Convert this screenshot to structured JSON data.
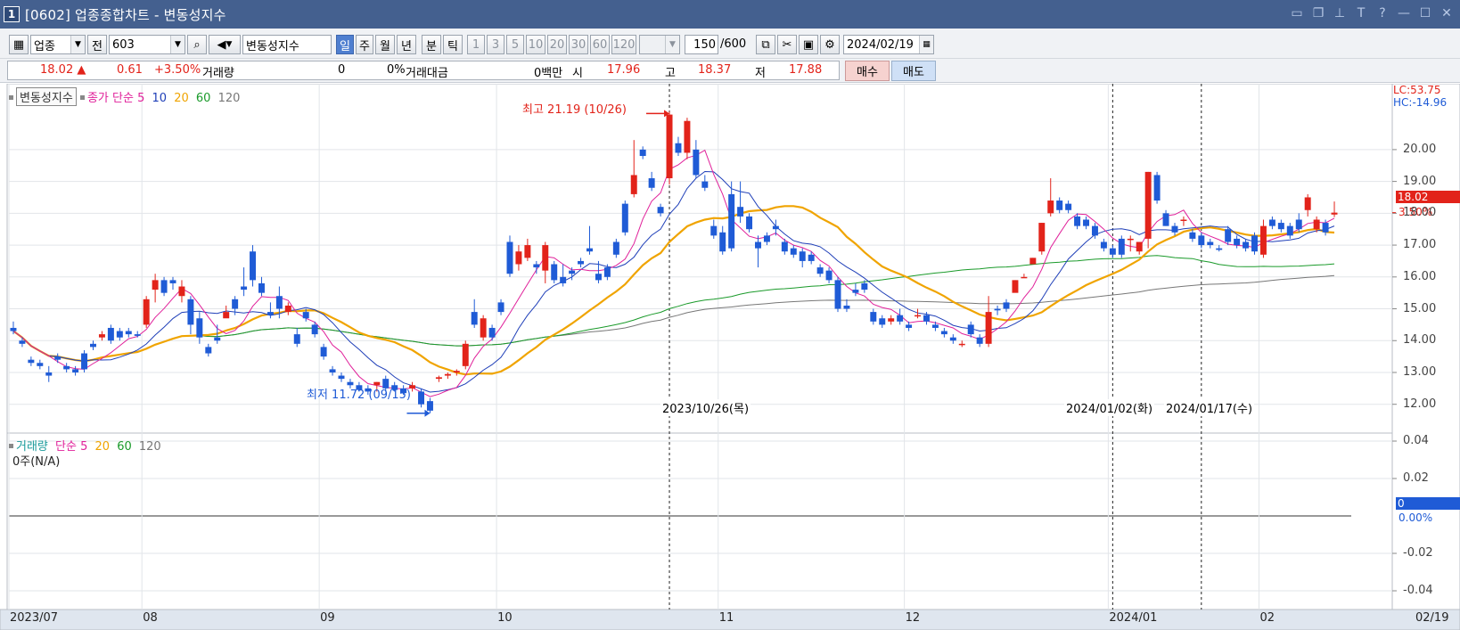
{
  "window": {
    "app_icon_text": "1",
    "title": "[0602] 업종종합차트 - 변동성지수",
    "buttons": [
      "▢",
      "❐",
      "📌",
      "T",
      "?",
      "—",
      "☐",
      "✕"
    ]
  },
  "toolbar": {
    "category_value": "업종",
    "jeon_label": "전",
    "code_value": "603",
    "search_icon": "search-icon",
    "index_name": "변동성지수",
    "period_buttons": [
      "일",
      "주",
      "월",
      "년",
      "분",
      "틱"
    ],
    "selected_period": "일",
    "interval_buttons": [
      "1",
      "3",
      "5",
      "10",
      "20",
      "30",
      "60",
      "120"
    ],
    "count_value": "150",
    "count_max": "/600",
    "date_value": "2024/02/19"
  },
  "price_info": {
    "current": "18.02 ▲",
    "change": "0.61",
    "change_pct": "+3.50%",
    "volume_label": "거래량",
    "volume_value": "0",
    "volume_pct": "0%",
    "amount_label": "거래대금",
    "amount_value": "0백만",
    "open_label": "시",
    "open_value": "17.96",
    "high_label": "고",
    "high_value": "18.37",
    "low_label": "저",
    "low_value": "17.88",
    "buy_label": "매수",
    "sell_label": "매도"
  },
  "price_legend": {
    "name": "변동성지수",
    "close_label": "종가 단순",
    "ma": [
      "5",
      "10",
      "20",
      "60",
      "120"
    ]
  },
  "volume_legend": {
    "name": "거래량",
    "ma_label": "단순",
    "ma": [
      "5",
      "20",
      "60",
      "120"
    ],
    "value_text": "0주(N/A)"
  },
  "annotations": {
    "high": "최고 21.19 (10/26)",
    "low": "최저 11.72 (09/15)",
    "lc": "LC:53.75",
    "hc": "HC:-14.96",
    "last_price": "18.02",
    "last_pct": "3.50%",
    "vol_last": "0",
    "vol_pct": "0.00%",
    "date_markers": [
      "2023/10/26(목)",
      "2024/01/02(화)",
      "2024/01/17(수)"
    ]
  },
  "colors": {
    "up": "#e2231a",
    "down": "#1f5bd6",
    "ma5": "#e0209a",
    "ma10": "#1f3fb8",
    "ma20": "#f0a400",
    "ma60": "#1a9a2a",
    "ma120": "#777777"
  },
  "x_axis_labels": [
    "2023/07",
    "08",
    "09",
    "10",
    "11",
    "12",
    "2024/01",
    "02",
    "02/19"
  ],
  "chart_data": {
    "type": "candlestick",
    "y_ticks": [
      "20.00",
      "19.00",
      "18.00",
      "17.00",
      "16.00",
      "15.00",
      "14.00",
      "13.00",
      "12.00"
    ],
    "ylim": [
      11.6,
      21.9
    ],
    "vol_ticks": [
      "0.04",
      "0.02",
      "-0.02",
      "-0.04"
    ],
    "vol_ylim": [
      -0.05,
      0.05
    ],
    "candles": [
      [
        14.4,
        14.6,
        14.2,
        14.3
      ],
      [
        14.0,
        14.1,
        13.8,
        13.9
      ],
      [
        13.4,
        13.5,
        13.2,
        13.3
      ],
      [
        13.3,
        13.4,
        13.1,
        13.2
      ],
      [
        13.0,
        13.2,
        12.7,
        12.9
      ],
      [
        13.5,
        13.6,
        13.3,
        13.4
      ],
      [
        13.2,
        13.3,
        13.0,
        13.1
      ],
      [
        13.1,
        13.2,
        12.9,
        13.0
      ],
      [
        13.6,
        13.7,
        13.0,
        13.1
      ],
      [
        13.9,
        14.0,
        13.7,
        13.8
      ],
      [
        14.1,
        14.3,
        14.0,
        14.2
      ],
      [
        14.4,
        14.5,
        13.9,
        14.0
      ],
      [
        14.3,
        14.4,
        14.0,
        14.1
      ],
      [
        14.3,
        14.4,
        14.1,
        14.2
      ],
      [
        14.2,
        14.3,
        14.1,
        14.15
      ],
      [
        14.5,
        15.4,
        14.4,
        15.3
      ],
      [
        15.6,
        16.1,
        15.2,
        15.9
      ],
      [
        15.9,
        16.0,
        15.4,
        15.5
      ],
      [
        15.9,
        16.0,
        15.6,
        15.8
      ],
      [
        15.4,
        15.9,
        15.2,
        15.7
      ],
      [
        15.3,
        15.4,
        14.2,
        14.5
      ],
      [
        14.7,
        14.9,
        13.9,
        14.1
      ],
      [
        13.8,
        13.9,
        13.5,
        13.6
      ],
      [
        14.1,
        14.5,
        13.9,
        14.0
      ],
      [
        14.7,
        15.1,
        14.8,
        14.9
      ],
      [
        15.3,
        15.4,
        14.8,
        15.0
      ],
      [
        15.7,
        16.3,
        15.4,
        15.6
      ],
      [
        16.8,
        17.0,
        15.7,
        15.9
      ],
      [
        15.8,
        16.0,
        15.4,
        15.5
      ],
      [
        14.9,
        15.2,
        14.7,
        14.8
      ],
      [
        15.4,
        15.7,
        14.7,
        15.0
      ],
      [
        14.9,
        15.2,
        14.8,
        15.1
      ],
      [
        14.2,
        14.4,
        13.8,
        13.9
      ],
      [
        14.9,
        15.0,
        14.6,
        14.7
      ],
      [
        14.5,
        14.6,
        14.1,
        14.2
      ],
      [
        13.8,
        13.9,
        13.4,
        13.5
      ],
      [
        13.1,
        13.2,
        12.9,
        13.0
      ],
      [
        12.9,
        13.0,
        12.7,
        12.8
      ],
      [
        12.7,
        12.8,
        12.5,
        12.6
      ],
      [
        12.6,
        12.7,
        12.4,
        12.45
      ],
      [
        12.5,
        12.6,
        12.3,
        12.4
      ],
      [
        12.6,
        12.7,
        12.4,
        12.7
      ],
      [
        12.8,
        12.9,
        12.4,
        12.5
      ],
      [
        12.6,
        12.7,
        12.4,
        12.45
      ],
      [
        12.5,
        12.6,
        12.3,
        12.35
      ],
      [
        12.5,
        12.7,
        12.4,
        12.6
      ],
      [
        12.4,
        12.5,
        11.9,
        12.0
      ],
      [
        12.1,
        12.2,
        11.72,
        11.8
      ],
      [
        12.8,
        12.9,
        12.7,
        12.85
      ],
      [
        12.9,
        13.0,
        12.8,
        12.95
      ],
      [
        13.0,
        13.1,
        12.9,
        13.05
      ],
      [
        13.2,
        14.0,
        13.1,
        13.9
      ],
      [
        14.9,
        15.3,
        14.4,
        14.5
      ],
      [
        14.1,
        14.8,
        14.0,
        14.7
      ],
      [
        14.4,
        14.5,
        14.0,
        14.1
      ],
      [
        15.2,
        15.3,
        14.8,
        14.9
      ],
      [
        17.1,
        17.3,
        16.0,
        16.1
      ],
      [
        16.4,
        17.0,
        16.2,
        16.8
      ],
      [
        16.6,
        17.2,
        16.5,
        17.0
      ],
      [
        16.4,
        16.5,
        16.1,
        16.3
      ],
      [
        16.2,
        17.1,
        15.8,
        17.0
      ],
      [
        16.4,
        16.5,
        15.8,
        15.9
      ],
      [
        16.0,
        16.4,
        15.7,
        15.8
      ],
      [
        16.2,
        16.3,
        15.9,
        16.1
      ],
      [
        16.5,
        16.6,
        16.3,
        16.4
      ],
      [
        16.9,
        17.6,
        16.7,
        16.8
      ],
      [
        16.1,
        16.5,
        15.8,
        15.9
      ],
      [
        16.3,
        16.4,
        15.9,
        16.0
      ],
      [
        17.1,
        17.2,
        16.6,
        16.7
      ],
      [
        18.3,
        18.4,
        17.3,
        17.4
      ],
      [
        18.6,
        20.3,
        18.5,
        19.2
      ],
      [
        20.0,
        20.1,
        19.7,
        19.8
      ],
      [
        19.1,
        19.3,
        18.7,
        18.8
      ],
      [
        18.2,
        18.3,
        17.9,
        18.0
      ],
      [
        19.1,
        21.19,
        18.9,
        21.1
      ],
      [
        20.2,
        20.4,
        19.8,
        19.9
      ],
      [
        19.9,
        21.0,
        19.7,
        20.9
      ],
      [
        20.0,
        20.3,
        19.1,
        19.2
      ],
      [
        19.0,
        19.2,
        18.7,
        18.8
      ],
      [
        17.6,
        17.8,
        17.2,
        17.3
      ],
      [
        17.4,
        17.6,
        16.7,
        16.8
      ],
      [
        18.6,
        19.0,
        16.8,
        16.9
      ],
      [
        18.2,
        19.0,
        17.7,
        17.9
      ],
      [
        17.9,
        18.0,
        17.4,
        17.5
      ],
      [
        17.1,
        17.3,
        16.3,
        16.9
      ],
      [
        17.3,
        17.4,
        17.0,
        17.1
      ],
      [
        17.6,
        17.8,
        17.3,
        17.5
      ],
      [
        17.1,
        17.2,
        16.7,
        16.8
      ],
      [
        16.9,
        17.0,
        16.6,
        16.7
      ],
      [
        16.8,
        16.9,
        16.3,
        16.5
      ],
      [
        16.7,
        16.8,
        16.4,
        16.5
      ],
      [
        16.3,
        16.4,
        16.0,
        16.1
      ],
      [
        16.2,
        16.3,
        15.8,
        15.9
      ],
      [
        15.9,
        16.0,
        14.9,
        15.0
      ],
      [
        15.1,
        15.3,
        14.9,
        15.0
      ],
      [
        15.6,
        15.8,
        15.4,
        15.5
      ],
      [
        15.8,
        15.9,
        15.5,
        15.6
      ],
      [
        14.9,
        15.0,
        14.5,
        14.6
      ],
      [
        14.7,
        14.8,
        14.4,
        14.5
      ],
      [
        14.6,
        14.8,
        14.5,
        14.7
      ],
      [
        14.8,
        15.0,
        14.5,
        14.6
      ],
      [
        14.5,
        14.6,
        14.3,
        14.4
      ],
      [
        14.8,
        15.0,
        14.7,
        14.8
      ],
      [
        14.8,
        14.9,
        14.5,
        14.6
      ],
      [
        14.5,
        14.6,
        14.3,
        14.4
      ],
      [
        14.3,
        14.4,
        14.1,
        14.2
      ],
      [
        14.1,
        14.2,
        13.9,
        14.0
      ],
      [
        13.9,
        14.0,
        13.8,
        13.9
      ],
      [
        14.5,
        14.6,
        14.1,
        14.2
      ],
      [
        14.1,
        14.2,
        13.8,
        13.9
      ],
      [
        13.9,
        15.4,
        13.8,
        14.9
      ],
      [
        15.0,
        15.1,
        14.8,
        14.95
      ],
      [
        15.2,
        15.3,
        14.9,
        15.0
      ],
      [
        15.5,
        15.6,
        15.9,
        15.9
      ],
      [
        16.0,
        16.1,
        16.0,
        16.0
      ],
      [
        16.4,
        16.6,
        16.4,
        16.6
      ],
      [
        16.8,
        17.7,
        16.7,
        17.7
      ],
      [
        18.0,
        19.1,
        17.9,
        18.4
      ],
      [
        18.4,
        18.5,
        18.0,
        18.1
      ],
      [
        18.3,
        18.4,
        18.0,
        18.1
      ],
      [
        17.9,
        18.0,
        17.5,
        17.6
      ],
      [
        17.8,
        17.9,
        17.5,
        17.6
      ],
      [
        17.6,
        17.7,
        17.2,
        17.3
      ],
      [
        17.1,
        17.2,
        16.8,
        16.9
      ],
      [
        16.9,
        17.0,
        16.6,
        16.7
      ],
      [
        17.2,
        17.3,
        16.6,
        16.7
      ],
      [
        17.2,
        17.3,
        16.8,
        17.2
      ],
      [
        16.8,
        17.1,
        16.7,
        17.1
      ],
      [
        17.2,
        19.3,
        16.9,
        19.3
      ],
      [
        19.2,
        19.3,
        18.3,
        18.4
      ],
      [
        18.0,
        18.1,
        17.6,
        17.6
      ],
      [
        17.6,
        17.7,
        17.3,
        17.4
      ],
      [
        17.8,
        17.9,
        17.6,
        17.8
      ],
      [
        17.4,
        17.5,
        17.1,
        17.2
      ],
      [
        17.3,
        17.4,
        16.9,
        17.0
      ],
      [
        17.1,
        17.2,
        16.9,
        17.0
      ],
      [
        16.9,
        17.0,
        16.8,
        16.85
      ],
      [
        17.5,
        17.6,
        17.0,
        17.1
      ],
      [
        17.2,
        17.3,
        16.9,
        17.0
      ],
      [
        17.1,
        17.2,
        16.8,
        16.9
      ],
      [
        17.3,
        17.4,
        16.7,
        16.8
      ],
      [
        16.7,
        17.8,
        16.6,
        17.6
      ],
      [
        17.8,
        17.9,
        17.5,
        17.6
      ],
      [
        17.7,
        17.8,
        17.4,
        17.5
      ],
      [
        17.6,
        17.7,
        17.2,
        17.3
      ],
      [
        17.8,
        18.0,
        17.4,
        17.5
      ],
      [
        18.1,
        18.6,
        17.9,
        18.5
      ],
      [
        17.5,
        17.9,
        17.4,
        17.8
      ],
      [
        17.7,
        17.8,
        17.3,
        17.4
      ],
      [
        17.96,
        18.37,
        17.88,
        18.02
      ]
    ]
  }
}
